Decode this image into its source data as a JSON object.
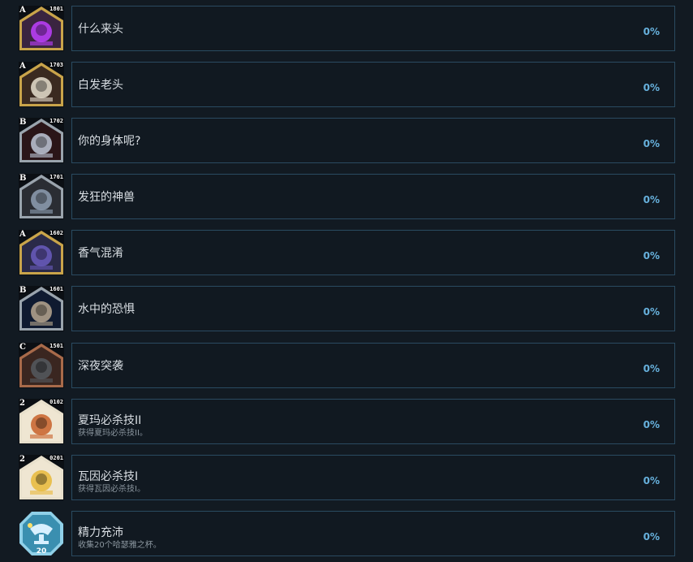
{
  "achievements": [
    {
      "title": "什么来头",
      "desc": "",
      "percent": "0%",
      "grade": "A",
      "code": "1801",
      "icon": "purple-spider-icon",
      "frame": "#c9a44a",
      "bg": "#3a2440",
      "accent": "#c040ff"
    },
    {
      "title": "白发老头",
      "desc": "",
      "percent": "0%",
      "grade": "A",
      "code": "1703",
      "icon": "white-haired-old-man-icon",
      "frame": "#c9a44a",
      "bg": "#3a2a20",
      "accent": "#e8e0d0"
    },
    {
      "title": "你的身体呢?",
      "desc": "",
      "percent": "0%",
      "grade": "B",
      "code": "1702",
      "icon": "demon-skull-icon",
      "frame": "#9aa4ad",
      "bg": "#2a1518",
      "accent": "#c0c8d8"
    },
    {
      "title": "发狂的神兽",
      "desc": "",
      "percent": "0%",
      "grade": "B",
      "code": "1701",
      "icon": "rampaging-beast-icon",
      "frame": "#9aa4ad",
      "bg": "#2a2d33",
      "accent": "#8fa0b4"
    },
    {
      "title": "香气混淆",
      "desc": "",
      "percent": "0%",
      "grade": "A",
      "code": "1602",
      "icon": "blue-eye-flower-icon",
      "frame": "#c9a44a",
      "bg": "#2a2a48",
      "accent": "#6a5cc0"
    },
    {
      "title": "水中的恐惧",
      "desc": "",
      "percent": "0%",
      "grade": "B",
      "code": "1601",
      "icon": "water-eel-icon",
      "frame": "#9aa4ad",
      "bg": "#0f1a30",
      "accent": "#b8a890"
    },
    {
      "title": "深夜突袭",
      "desc": "",
      "percent": "0%",
      "grade": "C",
      "code": "1501",
      "icon": "night-raid-beast-icon",
      "frame": "#a86a4a",
      "bg": "#3a2620",
      "accent": "#555a60"
    },
    {
      "title": "夏玛必杀技II",
      "desc": "获得夏玛必杀技II。",
      "percent": "0%",
      "grade": "2",
      "code": "0102",
      "icon": "shama-fox-girl-icon",
      "frame": "#e8e0cc",
      "bg": "#efe6d2",
      "accent": "#c8602a"
    },
    {
      "title": "瓦因必杀技I",
      "desc": "获得瓦因必杀技I。",
      "percent": "0%",
      "grade": "2",
      "code": "0201",
      "icon": "vine-warrior-icon",
      "frame": "#e8e0cc",
      "bg": "#efe6d2",
      "accent": "#e8b83a"
    },
    {
      "title": "精力充沛",
      "desc": "收集20个哈瑟雅之杯。",
      "percent": "0%",
      "grade": "",
      "code": "",
      "icon": "goblet-twenty-badge-icon",
      "frame": "#8fd0e8",
      "bg": "#3a8fb0",
      "accent": "#d8f0ff"
    }
  ]
}
